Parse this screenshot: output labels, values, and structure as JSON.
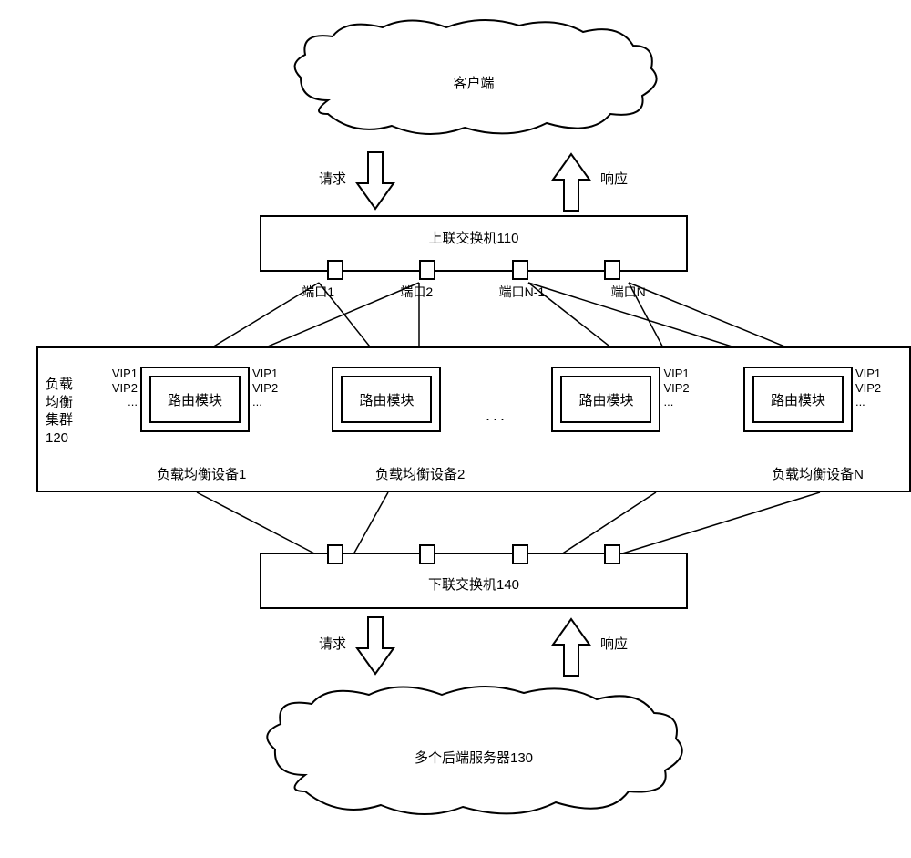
{
  "clouds": {
    "client": "客户端",
    "servers": "多个后端服务器130"
  },
  "arrows": {
    "request": "请求",
    "response": "响应"
  },
  "switches": {
    "uplink": {
      "title": "上联交换机110",
      "ports": [
        "端口1",
        "端口2",
        "端口N-1",
        "端口N"
      ]
    },
    "downlink": {
      "title": "下联交换机140"
    }
  },
  "cluster": {
    "label_line1": "负载",
    "label_line2": "均衡",
    "label_line3": "集群",
    "label_line4": "120",
    "route_module": "路由模块",
    "vip": {
      "v1": "VIP1",
      "v2": "VIP2",
      "v3": "..."
    },
    "device1": "负载均衡设备1",
    "device2": "负载均衡设备2",
    "deviceN": "负载均衡设备N",
    "ellipsis": "..."
  }
}
